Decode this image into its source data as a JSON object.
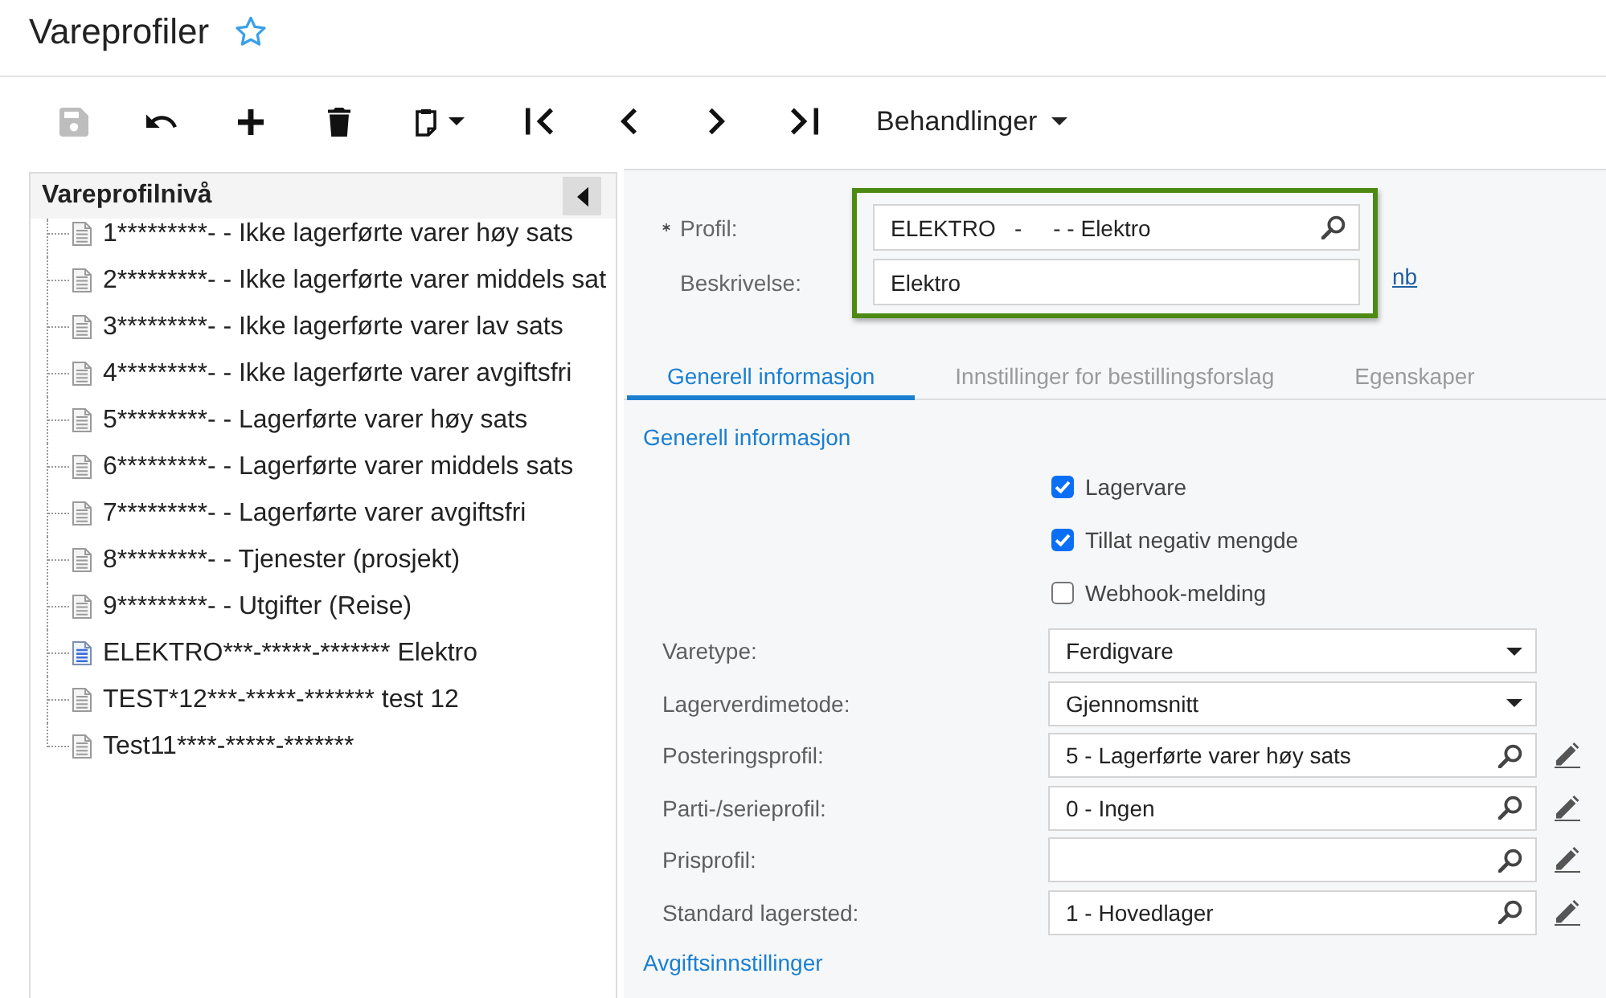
{
  "page_header": {
    "title": "Vareprofiler",
    "favorite": false
  },
  "toolbar": {
    "buttons": [
      {
        "kind": "save",
        "disabled": true
      },
      {
        "kind": "undo",
        "disabled": false
      },
      {
        "kind": "add",
        "disabled": false
      },
      {
        "kind": "delete",
        "disabled": false
      },
      {
        "kind": "paste",
        "disabled": false
      },
      {
        "kind": "first",
        "disabled": false
      },
      {
        "kind": "previous",
        "disabled": false
      },
      {
        "kind": "next",
        "disabled": false
      },
      {
        "kind": "last",
        "disabled": false
      }
    ],
    "actions_menu": {
      "label": "Behandlinger"
    }
  },
  "tree_panel": {
    "title": "Vareprofilnivå",
    "items": [
      {
        "label": "1*********- - Ikke lagerførte varer høy sats",
        "selected": false
      },
      {
        "label": "2*********- - Ikke lagerførte varer middels sat",
        "selected": false
      },
      {
        "label": "3*********- - Ikke lagerførte varer lav sats",
        "selected": false
      },
      {
        "label": "4*********- - Ikke lagerførte varer avgiftsfri",
        "selected": false
      },
      {
        "label": "5*********- - Lagerførte varer høy sats",
        "selected": false
      },
      {
        "label": "6*********- - Lagerførte varer middels sats",
        "selected": false
      },
      {
        "label": "7*********- - Lagerførte varer avgiftsfri",
        "selected": false
      },
      {
        "label": "8*********- - Tjenester (prosjekt)",
        "selected": false
      },
      {
        "label": "9*********- - Utgifter (Reise)",
        "selected": false
      },
      {
        "label": "ELEKTRO***-*****-******* Elektro",
        "selected": true
      },
      {
        "label": "TEST*12***-*****-******* test 12",
        "selected": false
      },
      {
        "label": "Test11****-*****-*******",
        "selected": false
      }
    ]
  },
  "header_form": {
    "highlighted": true,
    "fields": [
      {
        "kind": "lookup",
        "label": "Profil:",
        "required": true,
        "value": "ELEKTRO   -     - - Elektro"
      },
      {
        "kind": "text",
        "label": "Beskrivelse:",
        "required": false,
        "value": "Elektro"
      }
    ],
    "language_link": "nb"
  },
  "tabs": [
    {
      "label": "Generell informasjon",
      "selected": true
    },
    {
      "label": "Innstillinger for bestillingsforslag",
      "selected": false
    },
    {
      "label": "Egenskaper",
      "selected": false
    }
  ],
  "general_section": {
    "title": "Generell informasjon",
    "checkboxes": [
      {
        "label": "Lagervare",
        "checked": true
      },
      {
        "label": "Tillat negativ mengde",
        "checked": true
      },
      {
        "label": "Webhook-melding",
        "checked": false
      }
    ],
    "fields": [
      {
        "kind": "dropdown",
        "label": "Varetype:",
        "value": "Ferdigvare"
      },
      {
        "kind": "dropdown",
        "label": "Lagerverdimetode:",
        "value": "Gjennomsnitt"
      },
      {
        "kind": "lookup",
        "label": "Posteringsprofil:",
        "value": "5 - Lagerførte varer høy sats"
      },
      {
        "kind": "lookup",
        "label": "Parti-/serieprofil:",
        "value": "0 - Ingen"
      },
      {
        "kind": "lookup",
        "label": "Prisprofil:"
      },
      {
        "kind": "lookup",
        "label": "Standard lagersted:",
        "value": "1 - Hovedlager"
      }
    ]
  },
  "tax_section": {
    "title": "Avgiftsinnstillinger"
  }
}
